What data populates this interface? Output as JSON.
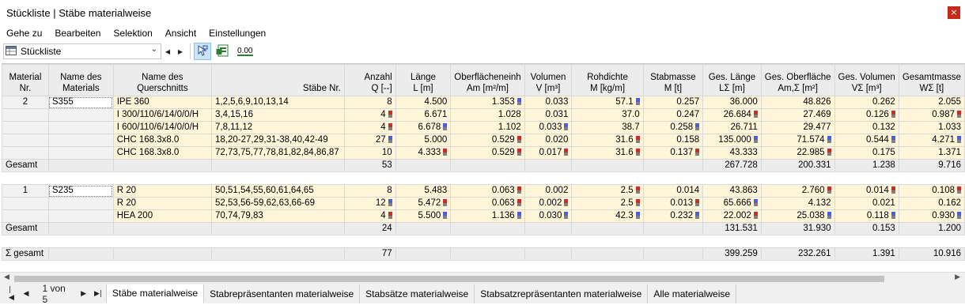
{
  "window": {
    "title": "Stückliste | Stäbe materialweise",
    "close_glyph": "×"
  },
  "menu": [
    "Gehe zu",
    "Bearbeiten",
    "Selektion",
    "Ansicht",
    "Einstellungen"
  ],
  "toolbar": {
    "select_value": "Stückliste",
    "decimal_icon_text": "0.00"
  },
  "columns": {
    "material_nr": [
      "Material",
      "Nr."
    ],
    "name_material": [
      "Name des",
      "Materials"
    ],
    "name_querschnitt": [
      "Name des",
      "Querschnitts"
    ],
    "staebe_nr": "Stäbe Nr.",
    "anzahl": [
      "Anzahl",
      "Q [--]"
    ],
    "laenge": [
      "Länge",
      "L [m]"
    ],
    "oberflaeche": [
      "Oberflächeneinh",
      "Am [m²/m]"
    ],
    "volumen": [
      "Volumen",
      "V [m³]"
    ],
    "rohdichte": [
      "Rohdichte",
      "M [kg/m]"
    ],
    "stabmasse": [
      "Stabmasse",
      "M [t]"
    ],
    "ges_laenge": [
      "Ges. Länge",
      "LΣ [m]"
    ],
    "ges_oberflaeche": [
      "Ges. Oberfläche",
      "Am,Σ [m²]"
    ],
    "ges_volumen": [
      "Ges. Volumen",
      "VΣ [m³]"
    ],
    "gesamtmasse": [
      "Gesamtmasse",
      "WΣ [t]"
    ]
  },
  "groups": [
    {
      "nr": "2",
      "material": "S355",
      "rows": [
        {
          "q": "IPE 360",
          "st": "1,2,5,6,9,10,13,14",
          "anz": "8",
          "anzM": "",
          "l": "4.500",
          "lM": "",
          "am": "1.353",
          "amM": "blue",
          "v": "0.033",
          "vM": "",
          "rho": "57.1",
          "rhoM": "blue",
          "m": "0.257",
          "mM": "",
          "gl": "36.000",
          "glM": "",
          "go": "48.826",
          "goM": "",
          "gv": "0.262",
          "gvM": "",
          "gm": "2.055",
          "gmM": ""
        },
        {
          "q": "I 300/110/6/14/0/0/H",
          "st": "3,4,15,16",
          "anz": "4",
          "anzM": "red",
          "l": "6.671",
          "lM": "",
          "am": "1.028",
          "amM": "",
          "v": "0.031",
          "vM": "",
          "rho": "37.0",
          "rhoM": "",
          "m": "0.247",
          "mM": "",
          "gl": "26.684",
          "glM": "red",
          "go": "27.469",
          "goM": "",
          "gv": "0.126",
          "gvM": "red",
          "gm": "0.987",
          "gmM": "red"
        },
        {
          "q": "I 600/110/6/14/0/0/H",
          "st": "7,8,11,12",
          "anz": "4",
          "anzM": "red",
          "l": "6.678",
          "lM": "blue",
          "am": "1.102",
          "amM": "",
          "v": "0.033",
          "vM": "blue",
          "rho": "38.7",
          "rhoM": "",
          "m": "0.258",
          "mM": "blue",
          "gl": "26.711",
          "glM": "",
          "go": "29.477",
          "goM": "",
          "gv": "0.132",
          "gvM": "",
          "gm": "1.033",
          "gmM": ""
        },
        {
          "q": "CHC 168.3x8.0",
          "st": "18,20-27,29,31-38,40,42-49",
          "anz": "27",
          "anzM": "blue",
          "l": "5.000",
          "lM": "",
          "am": "0.529",
          "amM": "red",
          "v": "0.020",
          "vM": "",
          "rho": "31.6",
          "rhoM": "red",
          "m": "0.158",
          "mM": "",
          "gl": "135.000",
          "glM": "blue",
          "go": "71.574",
          "goM": "blue",
          "gv": "0.544",
          "gvM": "blue",
          "gm": "4.271",
          "gmM": "blue"
        },
        {
          "q": "CHC 168.3x8.0",
          "st": "72,73,75,77,78,81,82,84,86,87",
          "anz": "10",
          "anzM": "",
          "l": "4.333",
          "lM": "red",
          "am": "0.529",
          "amM": "red",
          "v": "0.017",
          "vM": "red",
          "rho": "31.6",
          "rhoM": "red",
          "m": "0.137",
          "mM": "red",
          "gl": "43.333",
          "glM": "",
          "go": "22.985",
          "goM": "red",
          "gv": "0.175",
          "gvM": "",
          "gm": "1.371",
          "gmM": ""
        }
      ],
      "total": {
        "label": "Gesamt",
        "anz": "53",
        "gl": "267.728",
        "go": "200.331",
        "gv": "1.238",
        "gm": "9.716"
      }
    },
    {
      "nr": "1",
      "material": "S235",
      "rows": [
        {
          "q": "R 20",
          "st": "50,51,54,55,60,61,64,65",
          "anz": "8",
          "anzM": "",
          "l": "5.483",
          "lM": "",
          "am": "0.063",
          "amM": "red",
          "v": "0.002",
          "vM": "",
          "rho": "2.5",
          "rhoM": "red",
          "m": "0.014",
          "mM": "",
          "gl": "43.863",
          "glM": "",
          "go": "2.760",
          "goM": "red",
          "gv": "0.014",
          "gvM": "red",
          "gm": "0.108",
          "gmM": "red"
        },
        {
          "q": "R 20",
          "st": "52,53,56-59,62,63,66-69",
          "anz": "12",
          "anzM": "blue",
          "l": "5.472",
          "lM": "red",
          "am": "0.063",
          "amM": "red",
          "v": "0.002",
          "vM": "red",
          "rho": "2.5",
          "rhoM": "red",
          "m": "0.013",
          "mM": "red",
          "gl": "65.666",
          "glM": "blue",
          "go": "4.132",
          "goM": "",
          "gv": "0.021",
          "gvM": "",
          "gm": "0.162",
          "gmM": ""
        },
        {
          "q": "HEA 200",
          "st": "70,74,79,83",
          "anz": "4",
          "anzM": "red",
          "l": "5.500",
          "lM": "blue",
          "am": "1.136",
          "amM": "blue",
          "v": "0.030",
          "vM": "blue",
          "rho": "42.3",
          "rhoM": "blue",
          "m": "0.232",
          "mM": "blue",
          "gl": "22.002",
          "glM": "red",
          "go": "25.038",
          "goM": "blue",
          "gv": "0.118",
          "gvM": "blue",
          "gm": "0.930",
          "gmM": "blue"
        }
      ],
      "total": {
        "label": "Gesamt",
        "anz": "24",
        "gl": "131.531",
        "go": "31.930",
        "gv": "0.153",
        "gm": "1.200"
      }
    }
  ],
  "grand_total": {
    "label": "Σ gesamt",
    "anz": "77",
    "gl": "399.259",
    "go": "232.261",
    "gv": "1.391",
    "gm": "10.916"
  },
  "pager": {
    "text": "1 von 5"
  },
  "tabs": [
    "Stäbe materialweise",
    "Stabrepräsentanten materialweise",
    "Stabsätze materialweise",
    "Stabsatzrepräsentanten materialweise",
    "Alle materialweise"
  ],
  "active_tab": 0,
  "colors": {
    "marker_blue": "#4b5fd8",
    "marker_red": "#d02b2b",
    "row_fill": "#fff6da",
    "close": "#c42b1c"
  }
}
